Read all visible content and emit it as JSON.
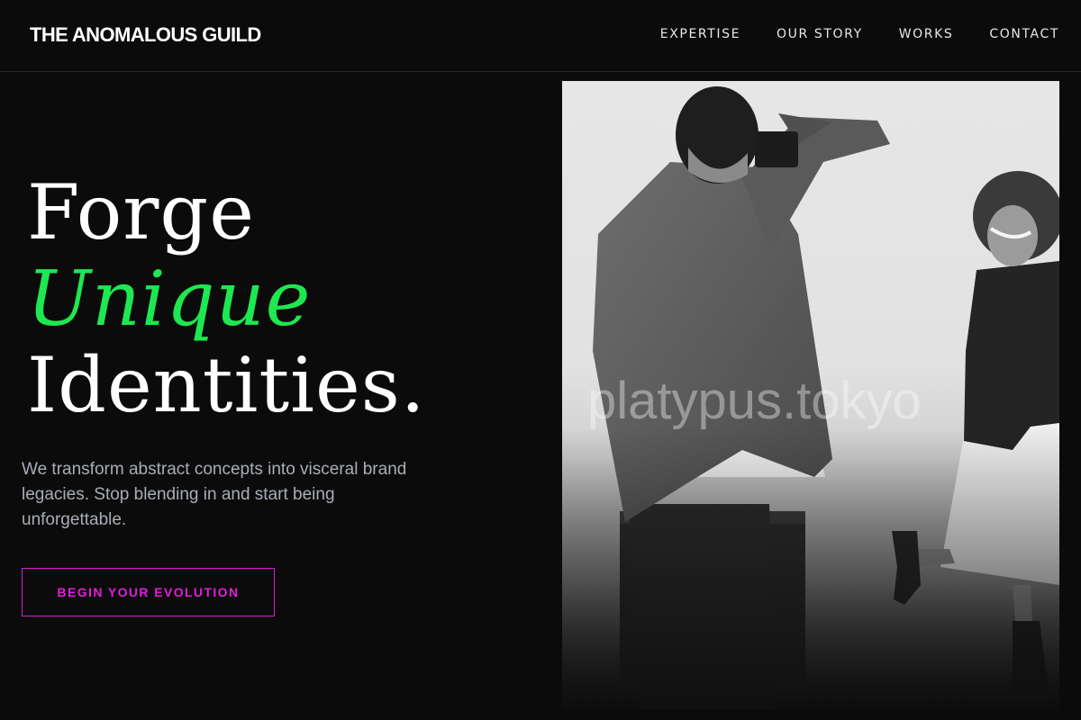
{
  "header": {
    "brand": "THE ANOMALOUS GUILD",
    "nav": [
      {
        "label": "EXPERTISE"
      },
      {
        "label": "OUR STORY"
      },
      {
        "label": "WORKS"
      },
      {
        "label": "CONTACT"
      }
    ]
  },
  "hero": {
    "headline": [
      "Forge",
      "Unique",
      "Identities."
    ],
    "description": "We transform abstract concepts into visceral brand legacies. Stop blending in and start being unforgettable.",
    "cta_label": "BEGIN YOUR EVOLUTION",
    "image_watermark": "platypus.tokyo"
  },
  "colors": {
    "background": "#0b0b0b",
    "accent_green": "#1ee84f",
    "accent_magenta": "#e11fda",
    "body_text": "#a9adb6"
  }
}
